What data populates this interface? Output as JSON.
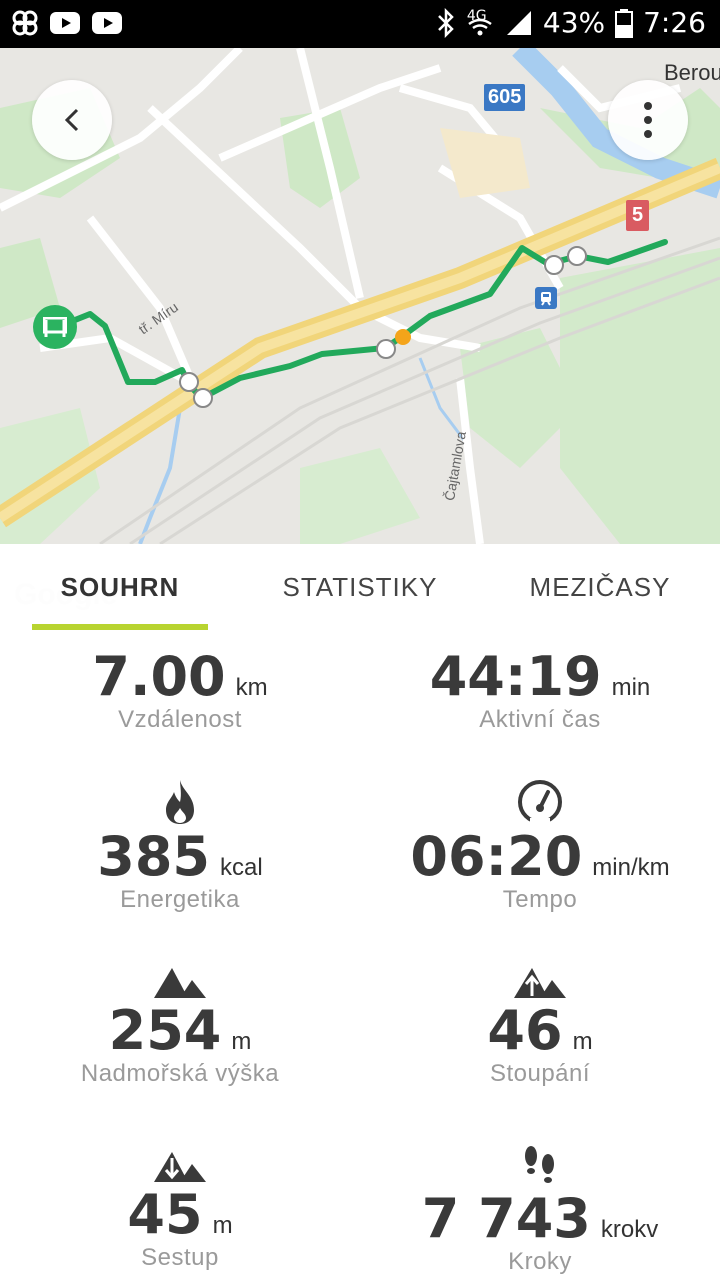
{
  "status_bar": {
    "network": "4G",
    "battery": "43%",
    "time": "7:26"
  },
  "map": {
    "place_label": "Berou",
    "route_badge_blue": "605",
    "route_badge_red": "5",
    "street_1": "tř. Míru",
    "street_2": "Čajtamlova"
  },
  "tabs": [
    {
      "label": "SOUHRN",
      "active": true
    },
    {
      "label": "STATISTIKY",
      "active": false
    },
    {
      "label": "MEZIČASY",
      "active": false
    }
  ],
  "stats": {
    "distance": {
      "value": "7.00",
      "unit": "km",
      "label": "Vzdálenost",
      "icon": "distance-icon"
    },
    "active_time": {
      "value": "44:19",
      "unit": "min",
      "label": "Aktivní čas",
      "icon": "clock-icon"
    },
    "energy": {
      "value": "385",
      "unit": "kcal",
      "label": "Energetika",
      "icon": "flame-icon"
    },
    "pace": {
      "value": "06:20",
      "unit": "min/km",
      "label": "Tempo",
      "icon": "speedometer-icon"
    },
    "altitude": {
      "value": "254",
      "unit": "m",
      "label": "Nadmořská výška",
      "icon": "mountain-icon"
    },
    "ascent": {
      "value": "46",
      "unit": "m",
      "label": "Stoupání",
      "icon": "ascent-icon"
    },
    "descent": {
      "value": "45",
      "unit": "m",
      "label": "Sestup",
      "icon": "descent-icon"
    },
    "steps": {
      "value": "7 743",
      "unit": "krokv",
      "label": "Kroky",
      "icon": "footsteps-icon"
    }
  },
  "colors": {
    "route": "#22a95b",
    "tab_underline": "#b8d430",
    "start_marker": "#2bb360",
    "current_marker": "#f4a41a"
  }
}
